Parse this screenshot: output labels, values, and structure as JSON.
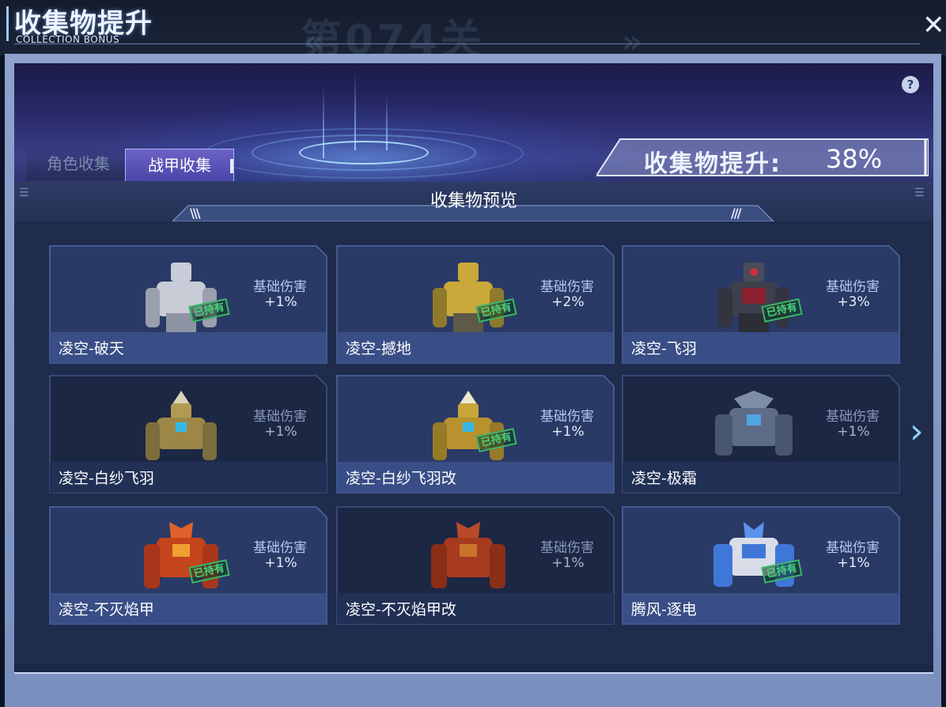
{
  "header": {
    "title": "收集物提升",
    "subtitle": "COLLECTION BONUS",
    "close_icon": "close-icon"
  },
  "background": {
    "stage_label": "第074关"
  },
  "banner": {
    "help_label": "?",
    "bonus_label": "收集物提升:",
    "bonus_value": "38%"
  },
  "tabs": [
    {
      "label": "角色收集",
      "active": false
    },
    {
      "label": "战甲收集",
      "active": true
    }
  ],
  "section": {
    "title": "收集物预览"
  },
  "cards": [
    {
      "name": "凌空-破天",
      "stat_label": "基础伤害",
      "stat_value": "+1%",
      "owned": true,
      "owned_label": "已持有",
      "color": "#c8ccd6"
    },
    {
      "name": "凌空-撼地",
      "stat_label": "基础伤害",
      "stat_value": "+2%",
      "owned": true,
      "owned_label": "已持有",
      "color": "#c9a93a"
    },
    {
      "name": "凌空-飞羽",
      "stat_label": "基础伤害",
      "stat_value": "+3%",
      "owned": true,
      "owned_label": "已持有",
      "color": "#6a3742"
    },
    {
      "name": "凌空-白纱飞羽",
      "stat_label": "基础伤害",
      "stat_value": "+1%",
      "owned": false,
      "owned_label": "",
      "color": "#b19a52"
    },
    {
      "name": "凌空-白纱飞羽改",
      "stat_label": "基础伤害",
      "stat_value": "+1%",
      "owned": true,
      "owned_label": "已持有",
      "color": "#c9a43a"
    },
    {
      "name": "凌空-极霜",
      "stat_label": "基础伤害",
      "stat_value": "+1%",
      "owned": false,
      "owned_label": "",
      "color": "#6c7c9a"
    },
    {
      "name": "凌空-不灭焰甲",
      "stat_label": "基础伤害",
      "stat_value": "+1%",
      "owned": true,
      "owned_label": "已持有",
      "color": "#c4441c"
    },
    {
      "name": "凌空-不灭焰甲改",
      "stat_label": "基础伤害",
      "stat_value": "+1%",
      "owned": false,
      "owned_label": "",
      "color": "#a83a20"
    },
    {
      "name": "腾风-逐电",
      "stat_label": "基础伤害",
      "stat_value": "+1%",
      "owned": true,
      "owned_label": "已持有",
      "color": "#3f77d8"
    }
  ],
  "nav": {
    "next_arrow": "›"
  }
}
